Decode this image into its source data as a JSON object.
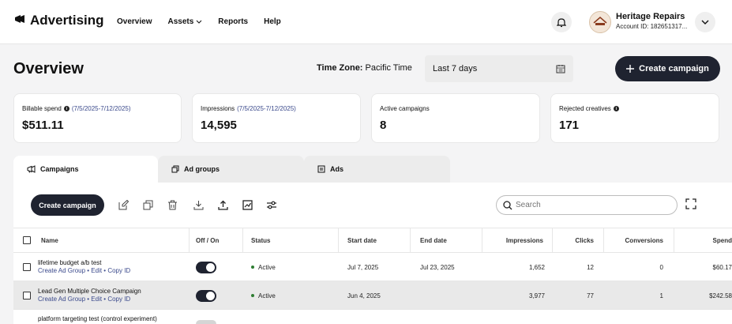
{
  "header": {
    "brand": "Advertising",
    "nav": [
      "Overview",
      "Assets",
      "Reports",
      "Help"
    ],
    "account_name": "Heritage Repairs",
    "account_id": "Account ID: 182651317..."
  },
  "page": {
    "title": "Overview",
    "timezone_label": "Time Zone:",
    "timezone_value": "Pacific Time",
    "date_range": "Last 7 days",
    "create_campaign": "Create campaign"
  },
  "cards": [
    {
      "label": "Billable spend",
      "range": "(7/5/2025-7/12/2025)",
      "value": "$511.11"
    },
    {
      "label": "Impressions",
      "range": "(7/5/2025-7/12/2025)",
      "value": "14,595"
    },
    {
      "label": "Active campaigns",
      "range": "",
      "value": "8"
    },
    {
      "label": "Rejected creatives",
      "range": "",
      "value": "171"
    }
  ],
  "tabs": [
    "Campaigns",
    "Ad groups",
    "Ads"
  ],
  "toolbar": {
    "create_label": "Create campaign",
    "search_placeholder": "Search"
  },
  "table": {
    "columns": [
      "Name",
      "Off / On",
      "Status",
      "Start date",
      "End date",
      "Impressions",
      "Clicks",
      "Conversions",
      "Spend"
    ],
    "rows": [
      {
        "name": "lifetime budget a/b test",
        "links": "Create Ad Group • Edit • Copy ID",
        "on": true,
        "status": "Active",
        "start": "Jul 7, 2025",
        "end": "Jul 23, 2025",
        "impressions": "1,652",
        "clicks": "12",
        "conversions": "0",
        "spend": "$60.17"
      },
      {
        "name": "Lead Gen Multiple Choice Campaign",
        "links": "Create Ad Group • Edit • Copy ID",
        "on": true,
        "status": "Active",
        "start": "Jun 4, 2025",
        "end": "",
        "impressions": "3,977",
        "clicks": "77",
        "conversions": "1",
        "spend": "$242.58"
      },
      {
        "name": "platform targeting test (control experiment)",
        "links": "",
        "on": true,
        "status": "",
        "start": "",
        "end": "",
        "impressions": "",
        "clicks": "",
        "conversions": "",
        "spend": ""
      }
    ]
  },
  "colors": {
    "primary_button": "#1f2330",
    "link": "#3b4a8c",
    "active_status": "#2e7d32"
  }
}
